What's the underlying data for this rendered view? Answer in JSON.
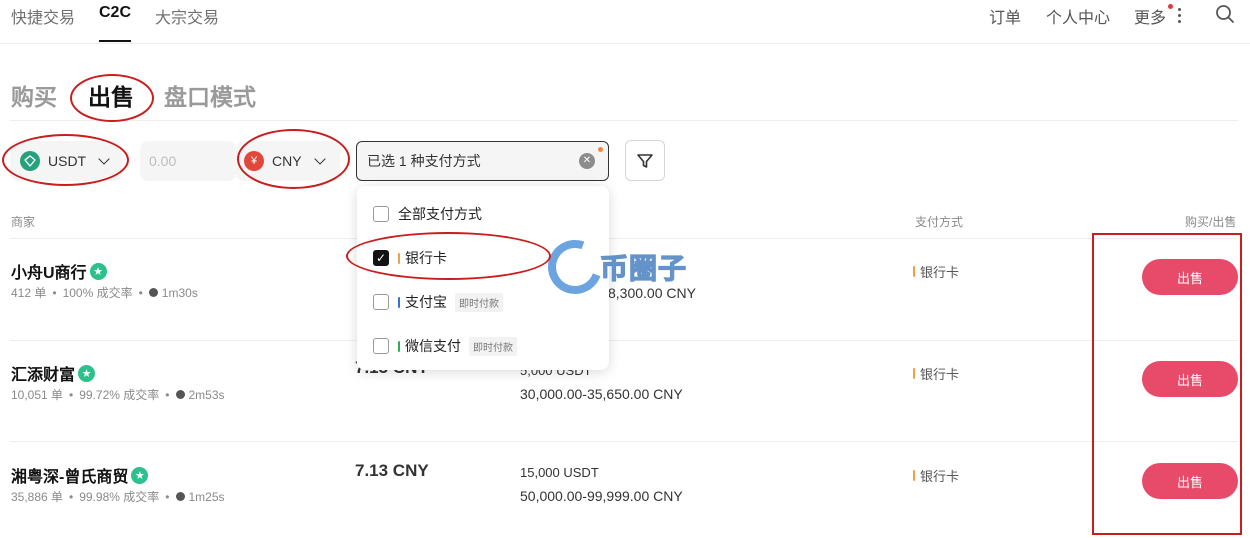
{
  "topnav": {
    "items": [
      "快捷交易",
      "C2C",
      "大宗交易"
    ],
    "right": {
      "orders": "订单",
      "account": "个人中心",
      "more": "更多"
    }
  },
  "tabs": [
    "购买",
    "出售",
    "盘口模式"
  ],
  "filters": {
    "coin": "USDT",
    "amount_placeholder": "0.00",
    "currency": "CNY",
    "payment_summary": "已选 1 种支付方式"
  },
  "payment_dropdown": {
    "items": [
      {
        "label": "全部支付方式",
        "checked": false,
        "tag": ""
      },
      {
        "label": "银行卡",
        "checked": true,
        "tag": "",
        "color": "#f0a045"
      },
      {
        "label": "支付宝",
        "checked": false,
        "tag": "即时付款",
        "color": "#3b6fd8"
      },
      {
        "label": "微信支付",
        "checked": false,
        "tag": "即时付款",
        "color": "#2fae5a"
      }
    ]
  },
  "table": {
    "headers": {
      "merchant": "商家",
      "payment": "支付方式",
      "action": "购买/出售"
    },
    "rows": [
      {
        "merchant": "小舟U商行",
        "orders": "412 单",
        "rate": "100% 成交率",
        "time": "1m30s",
        "price": "",
        "available": "",
        "limit": "8,300.00 CNY",
        "payment": "银行卡",
        "action": "出售"
      },
      {
        "merchant": "汇添财富",
        "orders": "10,051 单",
        "rate": "99.72% 成交率",
        "time": "2m53s",
        "price": "7.13 CNY",
        "available": "5,000 USDT",
        "limit": "30,000.00-35,650.00 CNY",
        "payment": "银行卡",
        "action": "出售"
      },
      {
        "merchant": "湘粤深-曾氏商贸",
        "orders": "35,886 单",
        "rate": "99.98% 成交率",
        "time": "1m25s",
        "price": "7.13 CNY",
        "available": "15,000 USDT",
        "limit": "50,000.00-99,999.00 CNY",
        "payment": "银行卡",
        "action": "出售"
      }
    ]
  },
  "watermark": "币圈子",
  "colors": {
    "sell": "#e84a6a",
    "verified": "#2dc08c",
    "usdt": "#26a17b",
    "cny": "#e0483b",
    "annotation": "#c81e1e"
  }
}
